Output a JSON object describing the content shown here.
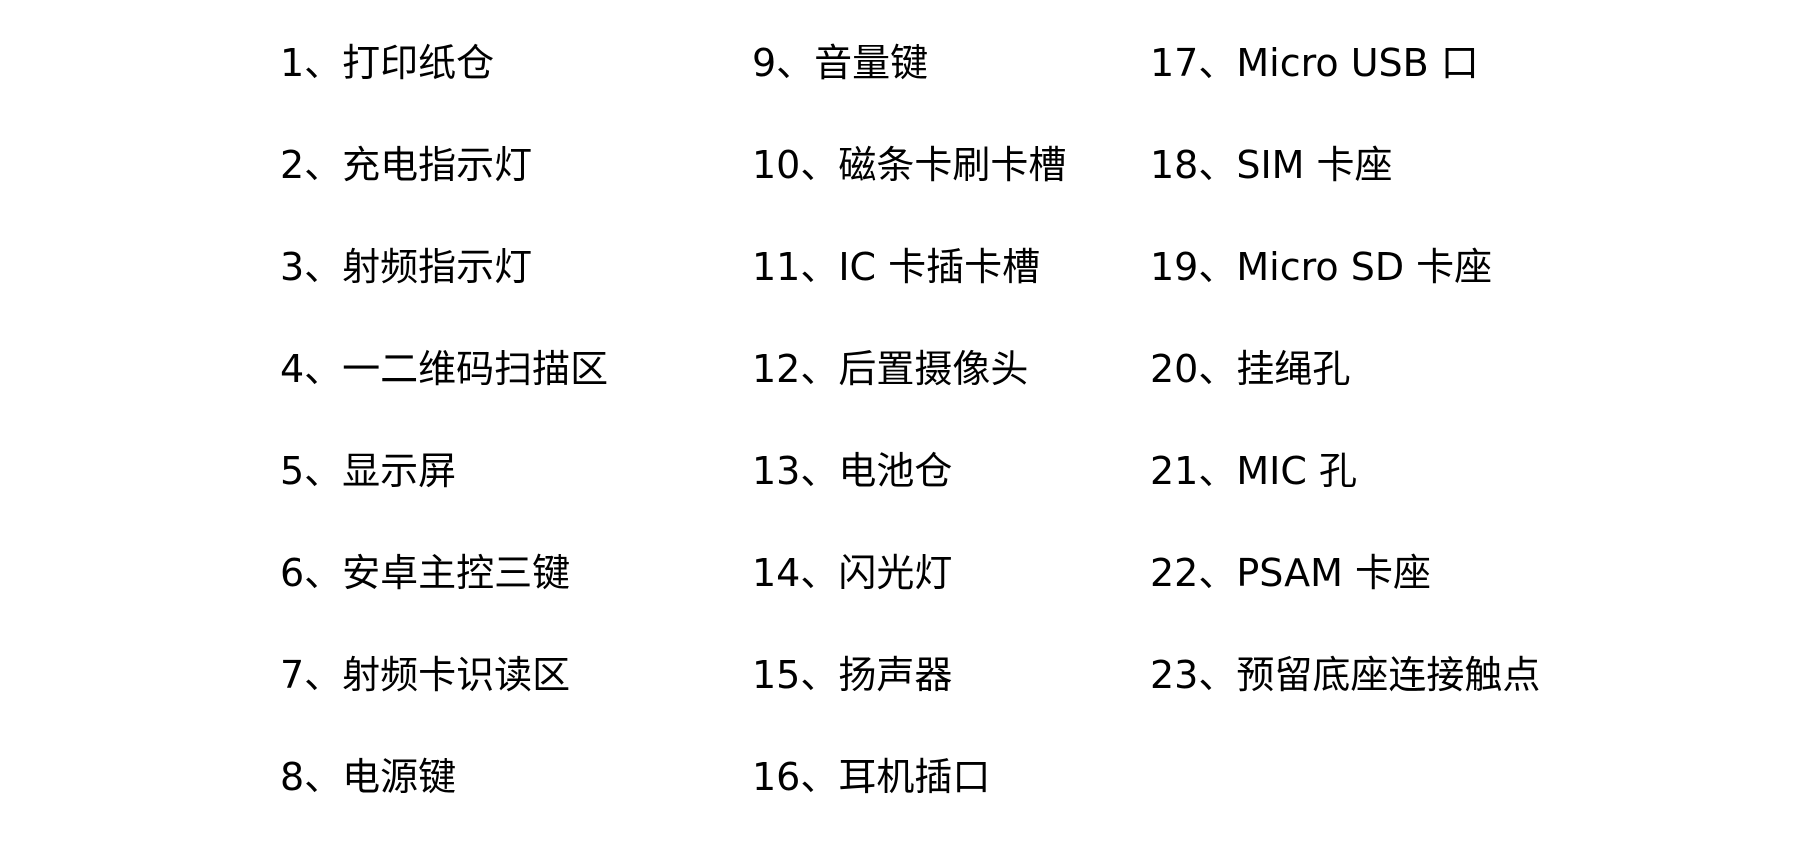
{
  "parts": {
    "column1": [
      "1、打印纸仓",
      "2、充电指示灯",
      "3、射频指示灯",
      "4、一二维码扫描区",
      "5、显示屏",
      "6、安卓主控三键",
      "7、射频卡识读区",
      "8、电源键"
    ],
    "column2": [
      "9、音量键",
      "10、磁条卡刷卡槽",
      "11、IC 卡插卡槽",
      "12、后置摄像头",
      "13、电池仓",
      "14、闪光灯",
      "15、扬声器",
      "16、耳机插口"
    ],
    "column3": [
      "17、Micro USB 口",
      "18、SIM 卡座",
      "19、Micro SD 卡座",
      "20、挂绳孔",
      "21、MIC 孔",
      "22、PSAM 卡座",
      "23、预留底座连接触点"
    ]
  }
}
